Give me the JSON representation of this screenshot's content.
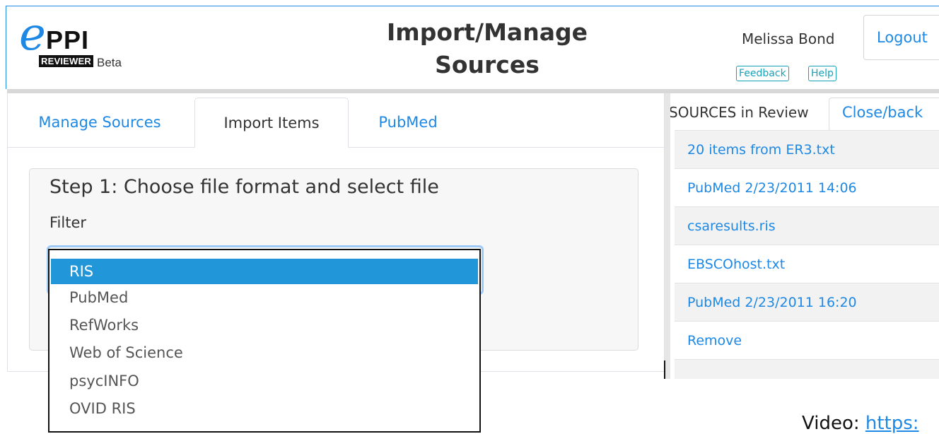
{
  "header": {
    "logo": {
      "letter": "e",
      "ppi": "PPI",
      "reviewer": "REVIEWER",
      "beta": "Beta"
    },
    "title_line1": "Import/Manage",
    "title_line2": "Sources",
    "user_name": "Melissa Bond",
    "logout_label": "Logout",
    "feedback_label": "Feedback",
    "help_label": "Help"
  },
  "tabs": [
    {
      "label": "Manage Sources",
      "active": false
    },
    {
      "label": "Import Items",
      "active": true
    },
    {
      "label": "PubMed",
      "active": false
    }
  ],
  "import": {
    "step_title": "Step 1: Choose file format and select file",
    "filter_label": "Filter",
    "filter_options": [
      "RIS",
      "PubMed",
      "RefWorks",
      "Web of Science",
      "psycINFO",
      "OVID RIS"
    ],
    "selected_option": "RIS"
  },
  "sources_panel": {
    "header": "SOURCES in Review",
    "close_label": "Close/back",
    "items": [
      "20 items from ER3.txt",
      "PubMed 2/23/2011 14:06",
      "csaresults.ris",
      "EBSCOhost.txt",
      "PubMed 2/23/2011 16:20",
      "Remove"
    ]
  },
  "footer": {
    "video_label": "Video:",
    "video_link": "https:"
  },
  "colors": {
    "accent": "#1e88e5",
    "selected": "#2196d8",
    "info": "#17a2b8"
  }
}
